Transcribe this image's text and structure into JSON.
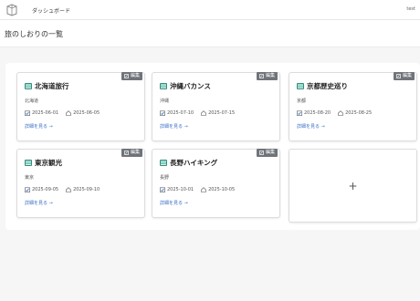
{
  "nav": {
    "dashboard_label": "ダッシュボード",
    "user_name": "test"
  },
  "page": {
    "title": "旅のしおりの一覧"
  },
  "card_labels": {
    "edit": "編集",
    "details": "詳細を見る →"
  },
  "trips": [
    {
      "title": "北海道旅行",
      "region": "北海道",
      "start": "2025-06-01",
      "end": "2025-06-05"
    },
    {
      "title": "沖縄バカンス",
      "region": "沖縄",
      "start": "2025-07-10",
      "end": "2025-07-15"
    },
    {
      "title": "京都歴史巡り",
      "region": "京都",
      "start": "2025-08-20",
      "end": "2025-08-25"
    },
    {
      "title": "東京観光",
      "region": "東京",
      "start": "2025-09-05",
      "end": "2025-09-10"
    },
    {
      "title": "長野ハイキング",
      "region": "長野",
      "start": "2025-10-01",
      "end": "2025-10-05"
    }
  ],
  "add_card": {
    "symbol": "+"
  },
  "colors": {
    "link": "#3a6fc9",
    "edit_button": "#6f747a",
    "map_icon": "#2f8f7f"
  }
}
